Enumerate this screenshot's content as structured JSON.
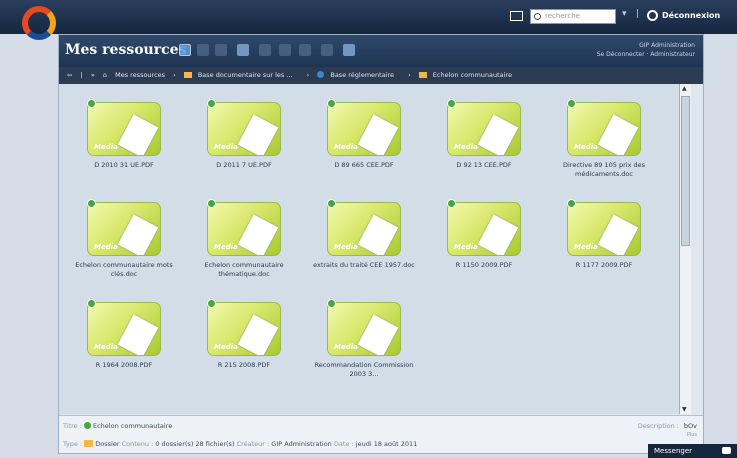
{
  "topbar": {
    "search_placeholder": "recherche",
    "logout_label": "Déconnexion"
  },
  "panel": {
    "title": "Mes ressources",
    "user_line1": "GIP Administration",
    "user_line2": "Se Déconnecter · Administrateur"
  },
  "breadcrumb": {
    "items": [
      "Mes ressources",
      "Base documentaire sur les ...",
      "Base réglementaire",
      "Echelon communautaire"
    ]
  },
  "items": [
    {
      "caption": "D 2010 31 UE.PDF"
    },
    {
      "caption": "D 2011 7 UE.PDF"
    },
    {
      "caption": "D 89 665 CEE.PDF"
    },
    {
      "caption": "D 92 13 CEE.PDF"
    },
    {
      "caption": "Directive 89 105 prix des médicaments.doc"
    },
    {
      "caption": "Echelon communautaire mots clés.doc"
    },
    {
      "caption": "Echelon communautaire thématique.doc"
    },
    {
      "caption": "extraits du traité CEE 1957.doc"
    },
    {
      "caption": "R 1150 2009.PDF"
    },
    {
      "caption": "R 1177 2009.PDF"
    },
    {
      "caption": "R 1964 2008.PDF"
    },
    {
      "caption": "R 215 2008.PDF"
    },
    {
      "caption": "Recommandation Commission 2003 3..."
    }
  ],
  "tile_label": "Media",
  "info": {
    "title_label": "Titre :",
    "title_value": "Echelon communautaire",
    "type_label": "Type :",
    "type_value": "Dossier",
    "content_label": "Contenu :",
    "content_value": "0 dossier(s) 28 fichier(s)",
    "creator_label": "Créateur :",
    "creator_value": "GIP Administration",
    "date_label": "Date :",
    "date_value": "jeudi 18 août 2011",
    "description_label": "Description :",
    "description_value": "bOv",
    "more": "Plus"
  },
  "messenger": {
    "label": "Messenger"
  }
}
